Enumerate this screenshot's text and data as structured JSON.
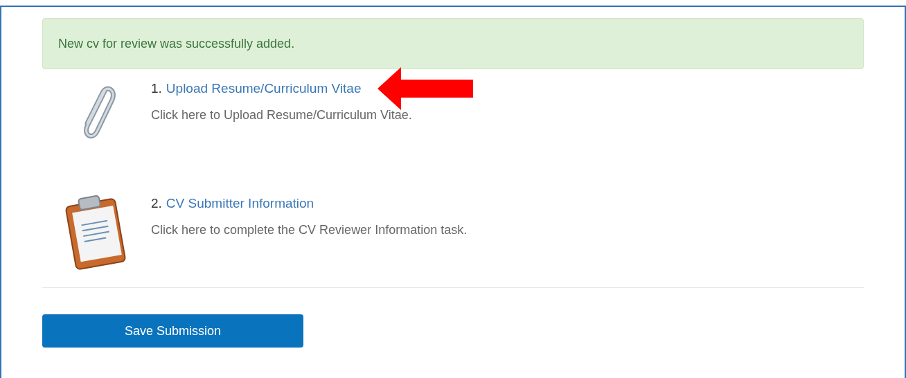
{
  "alert": {
    "message": "New cv for review was successfully added."
  },
  "tasks": [
    {
      "kind": "attachment",
      "number": "1.",
      "title": "Upload Resume/Curriculum Vitae",
      "description": "Click here to Upload Resume/Curriculum Vitae.",
      "annotated": true
    },
    {
      "kind": "form",
      "number": "2.",
      "title": "CV Submitter Information",
      "description": "Click here to complete the CV Reviewer Information task.",
      "annotated": false
    }
  ],
  "submit_button": {
    "label": "Save Submission"
  }
}
